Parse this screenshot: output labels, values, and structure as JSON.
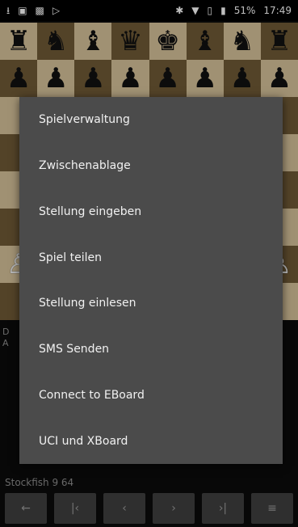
{
  "status_bar": {
    "battery": "51%",
    "time": "17:49",
    "icons_left": [
      "download-icon",
      "image-icon",
      "picture-icon",
      "play-store-icon"
    ],
    "icons_right": [
      "bluetooth-icon",
      "wifi-icon",
      "no-sim-icon",
      "battery-icon"
    ]
  },
  "board": {
    "row1": [
      "♜",
      "♞",
      "♝",
      "♛",
      "♚",
      "♝",
      "♞",
      "♜"
    ],
    "row2": [
      "♟",
      "♟",
      "♟",
      "♟",
      "♟",
      "♟",
      "♟",
      "♟"
    ],
    "row7": [
      "♙",
      "♙",
      "♙",
      "♙",
      "♙",
      "♙",
      "♙",
      "♙"
    ]
  },
  "side_text": {
    "line1": "D",
    "line2": "A"
  },
  "menu": {
    "items": [
      "Spielverwaltung",
      "Zwischenablage",
      "Stellung eingeben",
      "Spiel teilen",
      "Stellung einlesen",
      "SMS Senden",
      "Connect to EBoard",
      "UCI und XBoard"
    ]
  },
  "engine": {
    "label": "Stockfish 9 64"
  },
  "nav": {
    "buttons": [
      {
        "name": "back-arrow",
        "glyph": "←"
      },
      {
        "name": "first-move",
        "glyph": "|‹"
      },
      {
        "name": "prev-move",
        "glyph": "‹"
      },
      {
        "name": "next-move",
        "glyph": "›"
      },
      {
        "name": "last-move",
        "glyph": "›|"
      },
      {
        "name": "menu",
        "glyph": "≡"
      }
    ]
  }
}
